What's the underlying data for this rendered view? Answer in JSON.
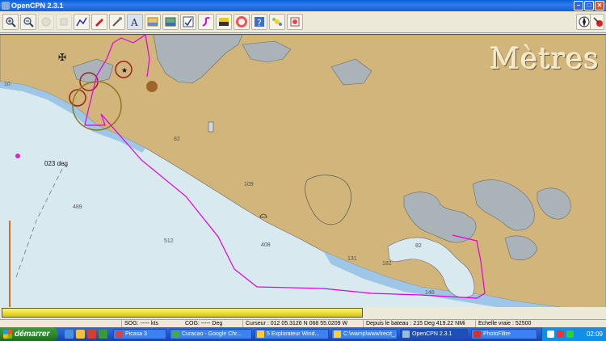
{
  "window": {
    "title": "OpenCPN 2.3.1",
    "controls": [
      "minimize",
      "maximize",
      "close"
    ]
  },
  "toolbar": {
    "buttons": [
      {
        "name": "zoom-in-icon",
        "enabled": true
      },
      {
        "name": "zoom-out-icon",
        "enabled": true
      },
      {
        "name": "scale-in-icon",
        "enabled": false
      },
      {
        "name": "scale-out-icon",
        "enabled": false
      },
      {
        "name": "route-icon",
        "enabled": true
      },
      {
        "name": "follow-ship-icon",
        "enabled": true
      },
      {
        "name": "settings-icon",
        "enabled": true
      },
      {
        "name": "text-icon",
        "enabled": true
      },
      {
        "name": "current-icon",
        "enabled": true
      },
      {
        "name": "tide-icon",
        "enabled": true
      },
      {
        "name": "route-manager-icon",
        "enabled": true
      },
      {
        "name": "track-icon",
        "enabled": true
      },
      {
        "name": "color-scheme-icon",
        "enabled": true
      },
      {
        "name": "mob-icon",
        "enabled": true
      },
      {
        "name": "help-icon",
        "enabled": true
      },
      {
        "name": "ais-icon",
        "enabled": true
      },
      {
        "name": "print-icon",
        "enabled": true
      }
    ],
    "right_buttons": [
      "compass-icon",
      "gps-status-icon"
    ]
  },
  "chart": {
    "units_label": "Mètres",
    "bearing_label": "023 deg",
    "soundings": [
      "82",
      "109",
      "489",
      "512",
      "408",
      "131",
      "182",
      "82",
      "146",
      "10"
    ],
    "colors": {
      "water": "#d8e9f0",
      "land": "#d2b57a",
      "shallow": "#9ec6e6",
      "built": "#a9b3b8",
      "route": "#e000e0"
    }
  },
  "progress": {
    "value": 1.0
  },
  "status": {
    "sog": "SOG: ----- kts",
    "cog": "COG: ----- Deg",
    "cursor": "Curseur : 012 05.3126 N 068 55.0209 W",
    "from_boat": "Depuis le bateau : 215 Deg  419.22 NMi",
    "scale": "Echelle vraie :     52500"
  },
  "taskbar": {
    "start_label": "démarrer",
    "tasks": [
      {
        "label": "Picasa 3",
        "color": "#d43"
      },
      {
        "label": "Curacao - Google Chr...",
        "color": "#4a4"
      },
      {
        "label": "5 Explorateur Wind...",
        "color": "#fc3"
      },
      {
        "label": "C:\\wamp\\www\\recit_...",
        "color": "#fc3"
      },
      {
        "label": "OpenCPN 2.3.1",
        "color": "#9bd"
      },
      {
        "label": "PhotoFiltre",
        "color": "#c33"
      }
    ],
    "active_task": "OpenCPN 2.3.1",
    "clock": "02:09"
  }
}
